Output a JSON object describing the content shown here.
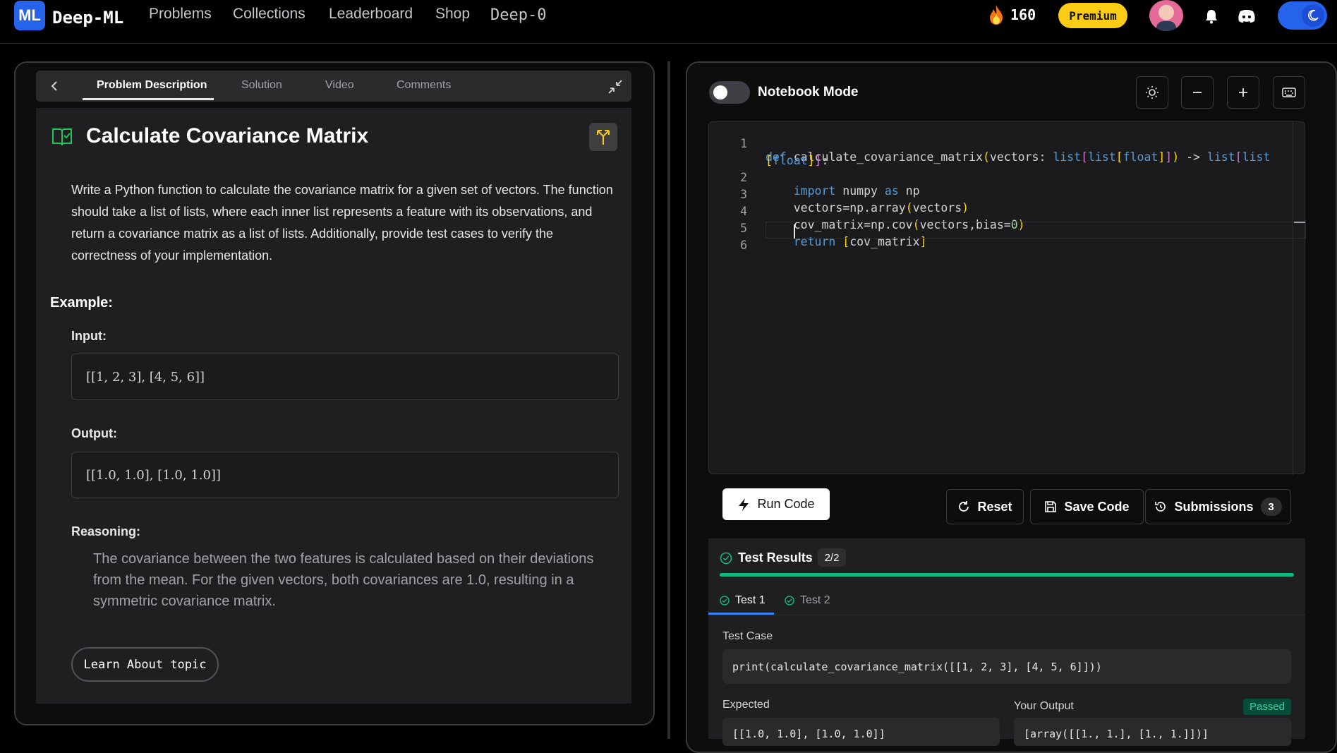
{
  "nav": {
    "logo_text": "ML",
    "brand": "Deep-ML",
    "links": [
      "Problems",
      "Collections",
      "Leaderboard",
      "Shop"
    ],
    "deep0": "Deep-0",
    "streak": "160",
    "premium": "Premium"
  },
  "left": {
    "tabs": [
      "Problem Description",
      "Solution",
      "Video",
      "Comments"
    ],
    "title": "Calculate Covariance Matrix",
    "description": "Write a Python function to calculate the covariance matrix for a given set of vectors. The function should take a list of lists, where each inner list represents a feature with its observations, and return a covariance matrix as a list of lists. Additionally, provide test cases to verify the correctness of your implementation.",
    "example_heading": "Example:",
    "input_label": "Input:",
    "input_value": "[[1, 2, 3], [4, 5, 6]]",
    "output_label": "Output:",
    "output_value": "[[1.0, 1.0], [1.0, 1.0]]",
    "reasoning_label": "Reasoning:",
    "reasoning_text": "The covariance between the two features is calculated based on their deviations from the mean. For the given vectors, both covariances are 1.0, resulting in a symmetric covariance matrix.",
    "learn_button": "Learn About topic"
  },
  "right": {
    "notebook_label": "Notebook Mode",
    "line_numbers": [
      "1",
      "2",
      "3",
      "4",
      "5",
      "6"
    ],
    "run_label": "Run Code",
    "reset_label": "Reset",
    "save_label": "Save Code",
    "submissions_label": "Submissions",
    "submissions_count": "3",
    "results": {
      "title": "Test Results",
      "badge": "2/2",
      "progress_fraction": 1.0,
      "tabs": [
        "Test 1",
        "Test 2"
      ],
      "test_case_label": "Test Case",
      "test_case_code": "print(calculate_covariance_matrix([[1, 2, 3], [4, 5, 6]]))",
      "expected_label": "Expected",
      "expected_value": "[[1.0, 1.0], [1.0, 1.0]]",
      "output_label": "Your Output",
      "output_value": "[array([[1., 1.], [1., 1.]])]",
      "status": "Passed"
    }
  },
  "colors": {
    "accent_blue": "#2563eb",
    "premium_yellow": "#facc15",
    "success_green": "#10b981"
  }
}
